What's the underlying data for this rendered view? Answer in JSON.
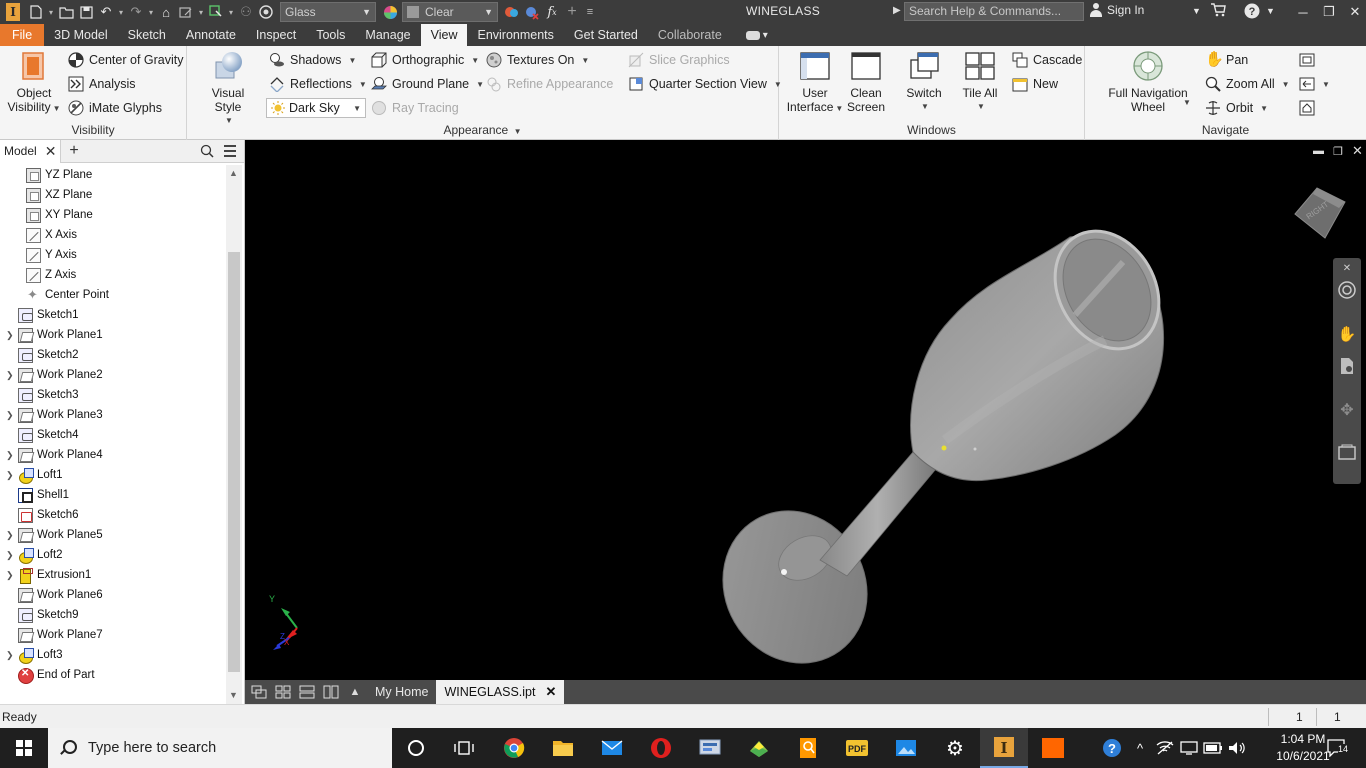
{
  "titlebar": {
    "app_logo": "I",
    "material_combo": "Glass",
    "appearance_combo": "Clear",
    "title": "WINEGLASS",
    "search_placeholder": "Search Help & Commands...",
    "sign_in": "Sign In",
    "icons": [
      "new-icon",
      "open-icon",
      "save-icon",
      "undo-icon",
      "redo-icon",
      "home-icon",
      "update-icon",
      "select-icon",
      "measure-icon",
      "color-wheel-icon",
      "appearance-icon",
      "clear-appearance-icon",
      "fx-icon",
      "plus-icon",
      "customize-icon",
      "cart-icon",
      "help-icon",
      "minimize-icon",
      "restore-icon",
      "close-icon"
    ]
  },
  "tabs": [
    "File",
    "3D Model",
    "Sketch",
    "Annotate",
    "Inspect",
    "Tools",
    "Manage",
    "View",
    "Environments",
    "Get Started",
    "Collaborate"
  ],
  "active_tab": "View",
  "ribbon": {
    "visibility": {
      "label": "Visibility",
      "object_visibility": [
        "Object",
        "Visibility"
      ],
      "items": [
        "Center of Gravity",
        "Analysis",
        "iMate Glyphs"
      ]
    },
    "appearance": {
      "label": "Appearance",
      "visual_style": "Visual Style",
      "col1": [
        "Shadows",
        "Reflections",
        "Dark Sky"
      ],
      "col2": [
        "Orthographic",
        "Ground Plane",
        "Ray Tracing"
      ],
      "col3": [
        "Textures On",
        "Refine Appearance"
      ],
      "col4": [
        "Slice Graphics",
        "Quarter Section View"
      ]
    },
    "windows": {
      "label": "Windows",
      "user_interface": [
        "User",
        "Interface"
      ],
      "clean_screen": [
        "Clean",
        "Screen"
      ],
      "switch": "Switch",
      "tile_all": "Tile All",
      "cascade": "Cascade",
      "new": "New"
    },
    "navigate": {
      "label": "Navigate",
      "full_nav": [
        "Full Navigation",
        "Wheel"
      ],
      "items": [
        "Pan",
        "Zoom All",
        "Orbit"
      ]
    }
  },
  "browser": {
    "tab": "Model",
    "tree": [
      {
        "label": "YZ Plane",
        "icon": "plane",
        "indent": 1,
        "expand": false
      },
      {
        "label": "XZ Plane",
        "icon": "plane",
        "indent": 1,
        "expand": false
      },
      {
        "label": "XY Plane",
        "icon": "plane",
        "indent": 1,
        "expand": false
      },
      {
        "label": "X Axis",
        "icon": "axis",
        "indent": 1,
        "expand": false
      },
      {
        "label": "Y Axis",
        "icon": "axis",
        "indent": 1,
        "expand": false
      },
      {
        "label": "Z Axis",
        "icon": "axis",
        "indent": 1,
        "expand": false
      },
      {
        "label": "Center Point",
        "icon": "point",
        "indent": 1,
        "expand": false
      },
      {
        "label": "Sketch1",
        "icon": "sketch",
        "indent": 0,
        "expand": false
      },
      {
        "label": "Work Plane1",
        "icon": "wp",
        "indent": 0,
        "expand": true
      },
      {
        "label": "Sketch2",
        "icon": "sketch",
        "indent": 0,
        "expand": false
      },
      {
        "label": "Work Plane2",
        "icon": "wp",
        "indent": 0,
        "expand": true
      },
      {
        "label": "Sketch3",
        "icon": "sketch",
        "indent": 0,
        "expand": false
      },
      {
        "label": "Work Plane3",
        "icon": "wp",
        "indent": 0,
        "expand": true
      },
      {
        "label": "Sketch4",
        "icon": "sketch",
        "indent": 0,
        "expand": false
      },
      {
        "label": "Work Plane4",
        "icon": "wp",
        "indent": 0,
        "expand": true
      },
      {
        "label": "Loft1",
        "icon": "loft",
        "indent": 0,
        "expand": true
      },
      {
        "label": "Shell1",
        "icon": "shell",
        "indent": 0,
        "expand": false
      },
      {
        "label": "Sketch6",
        "icon": "sketch-red",
        "indent": 0,
        "expand": false
      },
      {
        "label": "Work Plane5",
        "icon": "wp",
        "indent": 0,
        "expand": true
      },
      {
        "label": "Loft2",
        "icon": "loft",
        "indent": 0,
        "expand": true
      },
      {
        "label": "Extrusion1",
        "icon": "extr",
        "indent": 0,
        "expand": true
      },
      {
        "label": "Work Plane6",
        "icon": "wp",
        "indent": 0,
        "expand": false
      },
      {
        "label": "Sketch9",
        "icon": "sketch",
        "indent": 0,
        "expand": false
      },
      {
        "label": "Work Plane7",
        "icon": "wp",
        "indent": 0,
        "expand": false
      },
      {
        "label": "Loft3",
        "icon": "loft",
        "indent": 0,
        "expand": true
      },
      {
        "label": "End of Part",
        "icon": "end",
        "indent": 0,
        "expand": false
      }
    ]
  },
  "viewport": {
    "background": "#000000",
    "viewcube_label": "RIGHT",
    "triad": [
      "Y",
      "X",
      "Z"
    ]
  },
  "doc_tabs": {
    "home": "My Home",
    "active": "WINEGLASS.ipt"
  },
  "status": {
    "message": "Ready",
    "count1": "1",
    "count2": "1"
  },
  "taskbar": {
    "search_placeholder": "Type here to search",
    "time": "1:04 PM",
    "date": "10/6/2021",
    "notifications": "14"
  },
  "colors": {
    "accent_file": "#e8782c",
    "titlebar": "#3c3c3c",
    "ribbon": "#f5f5f5"
  }
}
